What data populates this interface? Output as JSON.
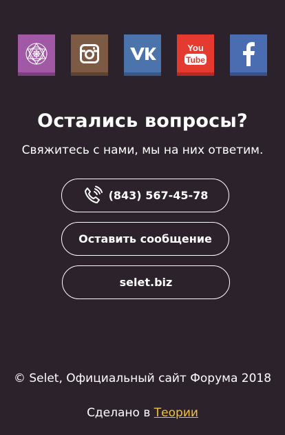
{
  "socials": [
    {
      "name": "ps",
      "icon": "mandala-icon",
      "color": "#a159a6"
    },
    {
      "name": "instagram",
      "icon": "instagram-icon",
      "color": "#7c5a44"
    },
    {
      "name": "vk",
      "icon": "vk-icon",
      "color": "#4a74ab"
    },
    {
      "name": "youtube",
      "icon": "youtube-icon",
      "color": "#e53a2f",
      "label_top": "You",
      "label_bottom": "Tube"
    },
    {
      "name": "facebook",
      "icon": "facebook-icon",
      "color": "#4a6cb0",
      "letter": "f"
    }
  ],
  "contact": {
    "title": "Остались вопросы?",
    "subtitle": "Свяжитесь с нами, мы на них ответим.",
    "phone_label": "(843) 567-45-78",
    "message_label": "Оставить сообщение",
    "site_label": "selet.biz"
  },
  "footer": {
    "copyright": "© Selet, Официальный сайт Форума 2018",
    "made_prefix": "Сделано в ",
    "made_link": "Теории"
  },
  "colors": {
    "background": "#2c222b",
    "link": "#f2c13b"
  }
}
